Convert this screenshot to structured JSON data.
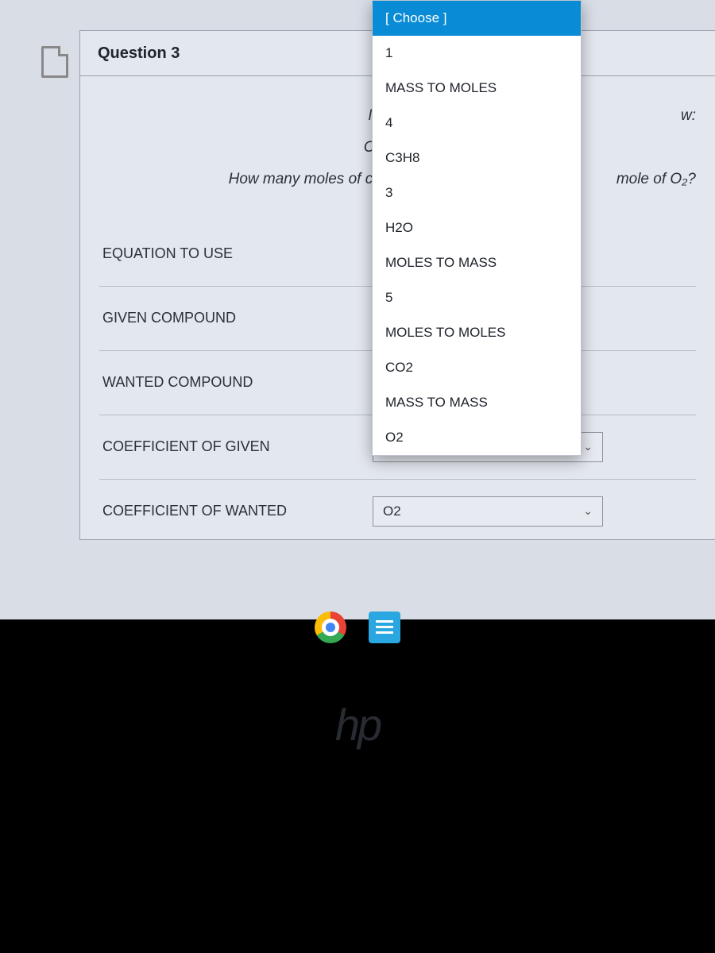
{
  "question": {
    "title": "Question 3",
    "intro_line1_left": "Match the foll",
    "intro_line1_right": "w:",
    "intro_formula_left": "C₃H₈",
    "intro_line3_left": "How many moles of carbo",
    "intro_line3_right": " mole of O₂?"
  },
  "rows": [
    {
      "label": "EQUATION TO USE"
    },
    {
      "label": "GIVEN COMPOUND"
    },
    {
      "label": "WANTED COMPOUND"
    },
    {
      "label": "COEFFICIENT OF GIVEN",
      "value": "[ Choose ]"
    },
    {
      "label": "COEFFICIENT OF WANTED",
      "value": "O2"
    }
  ],
  "dropdown": {
    "current": "[ Choose ]",
    "options": [
      "1",
      "MASS TO MOLES",
      "4",
      "C3H8",
      "3",
      "H2O",
      "MOLES TO MASS",
      "5",
      "MOLES TO MOLES",
      "CO2",
      "MASS TO MASS",
      "O2"
    ]
  },
  "branding": {
    "hp": "hp"
  }
}
